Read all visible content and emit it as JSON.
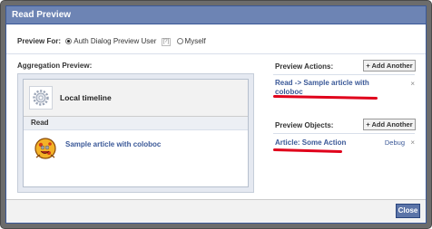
{
  "dialog": {
    "title": "Read Preview"
  },
  "preview_for": {
    "label": "Preview For:",
    "options": [
      {
        "label": "Auth Dialog Preview User",
        "selected": true
      },
      {
        "label": "Myself",
        "selected": false
      }
    ],
    "help": "[?]"
  },
  "aggregation": {
    "label": "Aggregation Preview:",
    "timeline_title": "Local timeline",
    "action_header": "Read",
    "article_link": "Sample article with coloboc"
  },
  "preview_actions": {
    "label": "Preview Actions:",
    "add_label": "+ Add Another",
    "item_line1": "Read -> Sample article with",
    "item_line2": "coloboc",
    "remove": "×"
  },
  "preview_objects": {
    "label": "Preview Objects:",
    "add_label": "+ Add Another",
    "item": "Article: Some Action",
    "debug": "Debug",
    "remove": "×"
  },
  "footer": {
    "close_label": "Close"
  },
  "colors": {
    "title_bar": "#6d84b4",
    "link": "#3b5998",
    "highlight": "#e0001b"
  }
}
